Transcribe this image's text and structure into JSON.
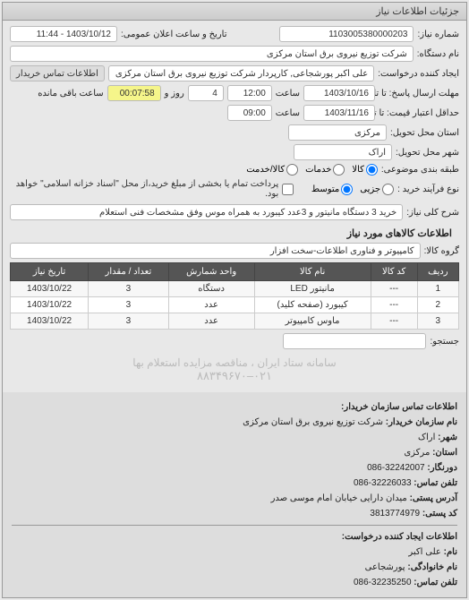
{
  "panel_title": "جزئیات اطلاعات نیاز",
  "form": {
    "req_no_label": "شماره نیاز:",
    "req_no": "1103005380000203",
    "announce_label": "تاریخ و ساعت اعلان عمومی:",
    "announce": "1403/10/12 - 11:44",
    "device_label": "نام دستگاه:",
    "device": "شرکت توزیع نیروی برق استان مرکزی",
    "creator_label": "ایجاد کننده درخواست:",
    "creator": "علی اکبر پورشجاعی, کارپردار شرکت توزیع نیروی برق استان مرکزی",
    "contact_button": "اطلاعات تماس خریدار",
    "deadline_label": "مهلت ارسال پاسخ: تا تاریخ:",
    "deadline_date": "1403/10/16",
    "time_label": "ساعت",
    "deadline_time": "12:00",
    "day_label": "روز و",
    "days": "4",
    "remain_label": "ساعت باقی مانده",
    "remain": "00:07:58",
    "validity_label": "حداقل اعتبار قیمت: تا تاریخ:",
    "validity_date": "1403/11/16",
    "validity_time": "09:00",
    "delivery_province_label": "استان محل تحویل:",
    "delivery_province": "مرکزی",
    "delivery_city_label": "شهر محل تحویل:",
    "delivery_city": "اراک",
    "pack_label": "طبقه بندی موضوعی:",
    "pack_opts": {
      "kala": "کالا",
      "khadamat": "خدمات",
      "both": "کالا/خدمت"
    },
    "buy_type_label": "نوع فرآیند خرید :",
    "buy_opts": {
      "jozi": "جزیی",
      "motevaset": "متوسط"
    },
    "payment_note": "پرداخت تمام یا بخشی از مبلغ خرید،از محل \"اسناد خزانه اسلامی\" خواهد بود.",
    "desc_label": "شرح کلی نیاز:",
    "desc": "خرید 3 دستگاه مانیتور و 3عدد کیبورد به همراه موس وفق مشخصات فنی استعلام",
    "group_section": "اطلاعات کالاهای مورد نیاز",
    "group_label": "گروه کالا:",
    "group": "کامپیوتر و فناوری اطلاعات-سخت افزار"
  },
  "table": {
    "headers": [
      "ردیف",
      "کد کالا",
      "نام کالا",
      "واحد شمارش",
      "تعداد / مقدار",
      "تاریخ نیاز"
    ],
    "rows": [
      {
        "n": "1",
        "code": "---",
        "name": "مانیتور LED",
        "unit": "دستگاه",
        "qty": "3",
        "date": "1403/10/22"
      },
      {
        "n": "2",
        "code": "---",
        "name": "کیبورد (صفحه کلید)",
        "unit": "عدد",
        "qty": "3",
        "date": "1403/10/22"
      },
      {
        "n": "3",
        "code": "---",
        "name": "ماوس کامپیوتر",
        "unit": "عدد",
        "qty": "3",
        "date": "1403/10/22"
      }
    ],
    "search_label": "جستجو:"
  },
  "watermark": {
    "line1": "سامانه ستاد ایران ، مناقصه مزایده استعلام بها",
    "line2": "۰۲۱–۸۸۳۴۹۶۷۰"
  },
  "contact": {
    "h1": "اطلاعات تماس سازمان خریدار:",
    "org_label": "نام سازمان خریدار:",
    "org": "شرکت توزیع نیروی برق استان مرکزی",
    "city_label": "شهر:",
    "city": "اراک",
    "province_label": "استان:",
    "province": "مرکزی",
    "fax_label": "دورنگار:",
    "fax": "32242007-086",
    "phone_label": "تلفن تماس:",
    "phone": "32226033-086",
    "addr_label": "آدرس پستی:",
    "addr": "میدان دارایی خیابان امام موسی صدر",
    "post_label": "کد پستی:",
    "post": "3813774979",
    "h2": "اطلاعات ایجاد کننده درخواست:",
    "fname_label": "نام:",
    "fname": "علی اکبر",
    "lname_label": "نام خانوادگی:",
    "lname": "پورشجاعی",
    "cphone_label": "تلفن تماس:",
    "cphone": "32235250-086"
  }
}
